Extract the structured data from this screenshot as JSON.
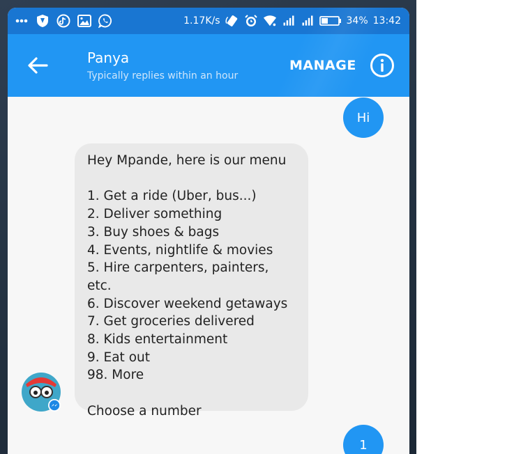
{
  "status_bar": {
    "left_icons": [
      "overflow-dots-icon",
      "shield-icon",
      "tiktok-icon",
      "gallery-icon",
      "whatsapp-icon"
    ],
    "speed": "1.17K/s",
    "battery": "34%",
    "time": "13:42"
  },
  "header": {
    "title": "Panya",
    "subtitle": "Typically replies within an hour",
    "manage_label": "MANAGE"
  },
  "messages": [
    {
      "from": "me",
      "text": "Hi"
    },
    {
      "from": "bot",
      "text": "Hey Mpande, here is our menu\n\n1. Get a ride (Uber, bus...)\n2. Deliver something\n3. Buy shoes & bags\n4. Events, nightlife & movies\n5. Hire carpenters, painters, etc.\n6. Discover weekend getaways\n7. Get groceries delivered\n8. Kids entertainment\n9. Eat out\n98. More\n\nChoose a number"
    },
    {
      "from": "me",
      "text": "1"
    }
  ],
  "colors": {
    "status_bar": "#1976d2",
    "app_bar": "#2196f3",
    "outgoing_bubble": "#2196f3",
    "incoming_bubble": "#e9e9e9"
  }
}
